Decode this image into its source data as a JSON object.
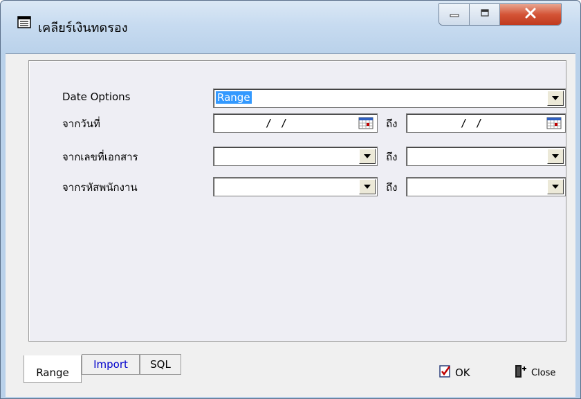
{
  "window": {
    "title": "เคลียร์เงินทดรอง",
    "icons": {
      "title": "form-icon",
      "minimize": "minimize-icon",
      "maximize": "maximize-icon",
      "close": "close-icon"
    }
  },
  "form": {
    "date_options": {
      "label": "Date Options",
      "value": "Range"
    },
    "from_date": {
      "label": "จากวันที่",
      "value": "/ /",
      "to_label": "ถึง",
      "to_value": "/ /"
    },
    "from_doc_no": {
      "label": "จากเลขที่เอกสาร",
      "value": "",
      "to_label": "ถึง",
      "to_value": ""
    },
    "from_emp_code": {
      "label": "จากรหัสพนักงาน",
      "value": "",
      "to_label": "ถึง",
      "to_value": ""
    }
  },
  "tabs": [
    {
      "label": "Range",
      "active": true
    },
    {
      "label": "Import",
      "active": false
    },
    {
      "label": "SQL",
      "active": false
    }
  ],
  "actions": {
    "ok_label": "OK",
    "close_label": "Close"
  },
  "colors": {
    "selection": "#3399ff",
    "link": "#0000cc",
    "titlebar": "#c7dbf0",
    "close_button": "#c9452a"
  }
}
